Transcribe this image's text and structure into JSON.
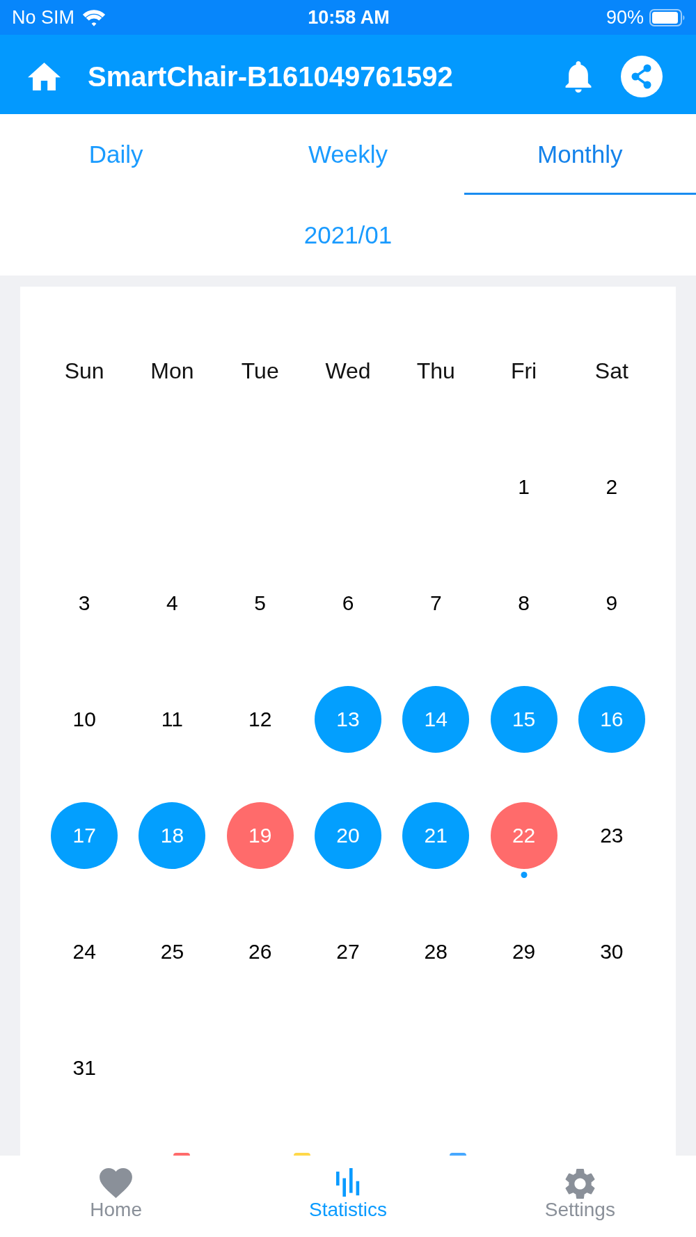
{
  "status_bar": {
    "carrier": "No SIM",
    "time": "10:58 AM",
    "battery": "90%"
  },
  "header": {
    "title": "SmartChair-B161049761592"
  },
  "tabs": [
    {
      "label": "Daily",
      "selected": false
    },
    {
      "label": "Weekly",
      "selected": false
    },
    {
      "label": "Monthly",
      "selected": true
    }
  ],
  "period": "2021/01",
  "calendar": {
    "weekdays": [
      "Sun",
      "Mon",
      "Tue",
      "Wed",
      "Thu",
      "Fri",
      "Sat"
    ],
    "days": [
      {
        "kind": "blank"
      },
      {
        "kind": "blank"
      },
      {
        "kind": "blank"
      },
      {
        "kind": "blank"
      },
      {
        "kind": "blank"
      },
      {
        "kind": "day",
        "label": "1",
        "today": false
      },
      {
        "kind": "day",
        "label": "2",
        "today": false
      },
      {
        "kind": "day",
        "label": "3",
        "today": false
      },
      {
        "kind": "day",
        "label": "4",
        "today": false
      },
      {
        "kind": "day",
        "label": "5",
        "today": false
      },
      {
        "kind": "day",
        "label": "6",
        "today": false
      },
      {
        "kind": "day",
        "label": "7",
        "today": false
      },
      {
        "kind": "day",
        "label": "8",
        "today": false
      },
      {
        "kind": "day",
        "label": "9",
        "today": false
      },
      {
        "kind": "day",
        "label": "10",
        "today": false
      },
      {
        "kind": "day",
        "label": "11",
        "today": false
      },
      {
        "kind": "day",
        "label": "12",
        "today": false
      },
      {
        "kind": "day",
        "label": "13",
        "today": false,
        "color": "#039ffe"
      },
      {
        "kind": "day",
        "label": "14",
        "today": false,
        "color": "#039ffe"
      },
      {
        "kind": "day",
        "label": "15",
        "today": false,
        "color": "#039ffe"
      },
      {
        "kind": "day",
        "label": "16",
        "today": false,
        "color": "#039ffe"
      },
      {
        "kind": "day",
        "label": "17",
        "today": false,
        "color": "#039ffe"
      },
      {
        "kind": "day",
        "label": "18",
        "today": false,
        "color": "#039ffe"
      },
      {
        "kind": "day",
        "label": "19",
        "today": false,
        "color": "#ff6b6b"
      },
      {
        "kind": "day",
        "label": "20",
        "today": false,
        "color": "#039ffe"
      },
      {
        "kind": "day",
        "label": "21",
        "today": false,
        "color": "#039ffe"
      },
      {
        "kind": "day",
        "label": "22",
        "today": true,
        "color": "#ff6b6b"
      },
      {
        "kind": "day",
        "label": "23",
        "today": false
      },
      {
        "kind": "day",
        "label": "24",
        "today": false
      },
      {
        "kind": "day",
        "label": "25",
        "today": false
      },
      {
        "kind": "day",
        "label": "26",
        "today": false
      },
      {
        "kind": "day",
        "label": "27",
        "today": false
      },
      {
        "kind": "day",
        "label": "28",
        "today": false
      },
      {
        "kind": "day",
        "label": "29",
        "today": false
      },
      {
        "kind": "day",
        "label": "30",
        "today": false
      },
      {
        "kind": "day",
        "label": "31",
        "today": false
      }
    ]
  },
  "legend": [
    {
      "color": "#ff6b6b"
    },
    {
      "color": "#ffd84a"
    },
    {
      "color": "#47a8ff"
    }
  ],
  "bottom_nav": [
    {
      "label": "Home",
      "selected": false
    },
    {
      "label": "Statistics",
      "selected": true
    },
    {
      "label": "Settings",
      "selected": false
    }
  ]
}
